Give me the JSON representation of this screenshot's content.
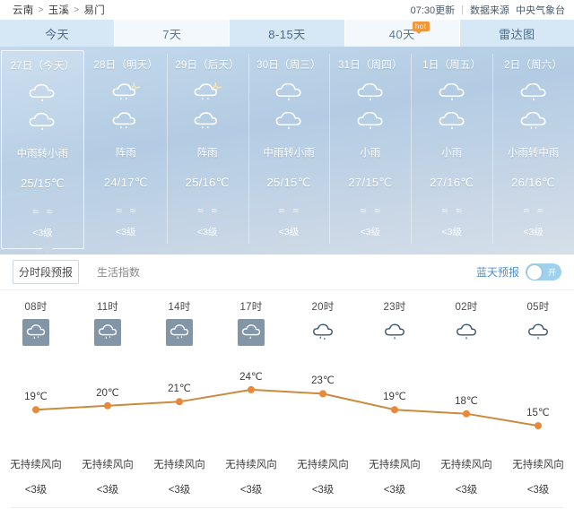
{
  "header": {
    "breadcrumb": [
      "云南",
      "玉溪",
      "易门"
    ],
    "separator": ">",
    "update_time": "07:30更新",
    "divider": "|",
    "source_label": "数据来源",
    "source_name": "中央气象台"
  },
  "tabs": [
    {
      "label": "今天",
      "active": true,
      "badge": null
    },
    {
      "label": "7天",
      "active": false,
      "badge": null
    },
    {
      "label": "8-15天",
      "active": false,
      "badge": null
    },
    {
      "label": "40天",
      "active": false,
      "badge": "hot"
    },
    {
      "label": "雷达图",
      "active": false,
      "badge": null
    }
  ],
  "week": [
    {
      "date": "27日（今天）",
      "desc": "中雨转小雨",
      "temp": "25/15℃",
      "wind_waves": "≈≈",
      "wind_level": "<3级",
      "icons": [
        "rain-moderate",
        "rain-light"
      ],
      "selected": true
    },
    {
      "date": "28日（明天）",
      "desc": "阵雨",
      "temp": "24/17℃",
      "wind_waves": "≈≈",
      "wind_level": "<3级",
      "icons": [
        "shower-sun",
        "shower"
      ],
      "selected": false
    },
    {
      "date": "29日（后天）",
      "desc": "阵雨",
      "temp": "25/16℃",
      "wind_waves": "≈≈",
      "wind_level": "<3级",
      "icons": [
        "shower-sun",
        "shower"
      ],
      "selected": false
    },
    {
      "date": "30日（周三）",
      "desc": "中雨转小雨",
      "temp": "25/15℃",
      "wind_waves": "≈≈",
      "wind_level": "<3级",
      "icons": [
        "rain-moderate",
        "rain-light"
      ],
      "selected": false
    },
    {
      "date": "31日（周四）",
      "desc": "小雨",
      "temp": "27/15℃",
      "wind_waves": "≈≈",
      "wind_level": "<3级",
      "icons": [
        "rain-light",
        "rain-light"
      ],
      "selected": false
    },
    {
      "date": "1日（周五）",
      "desc": "小雨",
      "temp": "27/16℃",
      "wind_waves": "≈≈",
      "wind_level": "<3级",
      "icons": [
        "rain-light",
        "rain-light"
      ],
      "selected": false
    },
    {
      "date": "2日（周六）",
      "desc": "小雨转中雨",
      "temp": "26/16℃",
      "wind_waves": "≈≈",
      "wind_level": "<3级",
      "icons": [
        "rain-light",
        "rain-moderate"
      ],
      "selected": false
    }
  ],
  "subbar": {
    "tabs": [
      {
        "label": "分时段预报",
        "active": true
      },
      {
        "label": "生活指数",
        "active": false
      }
    ],
    "sky_forecast_label": "蓝天预报",
    "toggle_state_text": "开",
    "toggle_on": true
  },
  "chart_data": {
    "type": "line",
    "title": "",
    "xlabel": "",
    "ylabel": "",
    "categories": [
      "08时",
      "11时",
      "14时",
      "17时",
      "20时",
      "23时",
      "02时",
      "05时"
    ],
    "values": [
      19,
      20,
      21,
      24,
      23,
      19,
      18,
      15
    ],
    "point_labels": [
      "19℃",
      "20℃",
      "21℃",
      "24℃",
      "23℃",
      "19℃",
      "18℃",
      "15℃"
    ],
    "unit": "℃",
    "ylim": [
      13,
      26
    ],
    "grid": false,
    "legend": "none",
    "line_color": "#cb8a3e",
    "point_color": "#e8883a",
    "hour_icons": [
      {
        "hour": "08时",
        "icon": "rain-heavy-boxed",
        "boxed": true
      },
      {
        "hour": "11时",
        "icon": "rain-heavy-boxed",
        "boxed": true
      },
      {
        "hour": "14时",
        "icon": "rain-heavy-boxed",
        "boxed": true
      },
      {
        "hour": "17时",
        "icon": "rain-heavy-boxed",
        "boxed": true
      },
      {
        "hour": "20时",
        "icon": "rain-light-outline",
        "boxed": false
      },
      {
        "hour": "23时",
        "icon": "rain-light-outline",
        "boxed": false
      },
      {
        "hour": "02时",
        "icon": "rain-light-outline",
        "boxed": false
      },
      {
        "hour": "05时",
        "icon": "rain-light-outline",
        "boxed": false
      }
    ],
    "wind": [
      {
        "dir": "无持续风向",
        "level": "<3级"
      },
      {
        "dir": "无持续风向",
        "level": "<3级"
      },
      {
        "dir": "无持续风向",
        "level": "<3级"
      },
      {
        "dir": "无持续风向",
        "level": "<3级"
      },
      {
        "dir": "无持续风向",
        "level": "<3级"
      },
      {
        "dir": "无持续风向",
        "level": "<3级"
      },
      {
        "dir": "无持续风向",
        "level": "<3级"
      },
      {
        "dir": "无持续风向",
        "level": "<3级"
      }
    ]
  },
  "colors": {
    "tab_active_bg": "#d6e7f5",
    "tab_inactive_bg": "#f3f8fd",
    "panel_top": "#c4d9ec",
    "panel_bottom": "#d6dfe9",
    "accent_orange": "#e8883a",
    "hot_badge": "#f0973c",
    "toggle_on": "#9fd0ee",
    "icon_box": "#8296a8"
  }
}
